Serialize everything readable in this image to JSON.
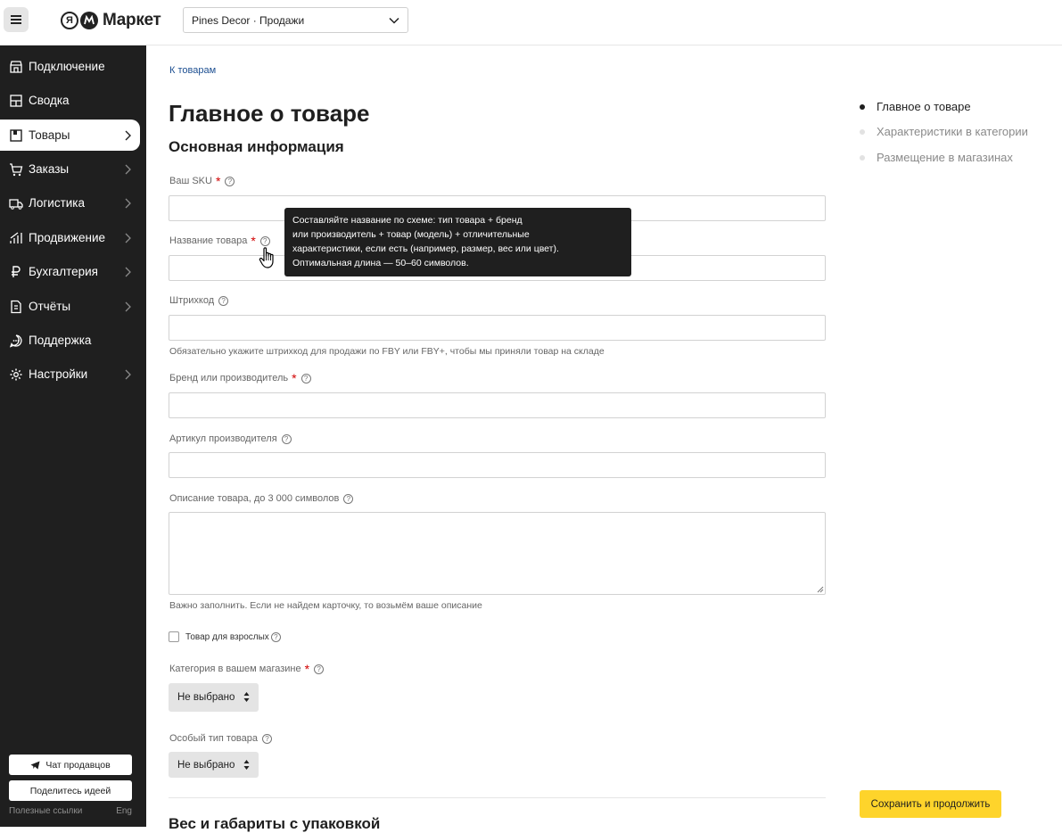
{
  "header": {
    "logo_text": "Маркет",
    "logo_ya": "Я",
    "shop_name": "Pines Decor · Продажи"
  },
  "sidebar": {
    "items": [
      {
        "label": "Подключение",
        "icon": "store-icon",
        "arrow": false
      },
      {
        "label": "Сводка",
        "icon": "dashboard-icon",
        "arrow": false
      },
      {
        "label": "Товары",
        "icon": "box-icon",
        "arrow": true,
        "active": true
      },
      {
        "label": "Заказы",
        "icon": "cart-icon",
        "arrow": true
      },
      {
        "label": "Логистика",
        "icon": "truck-icon",
        "arrow": true
      },
      {
        "label": "Продвижение",
        "icon": "chart-icon",
        "arrow": true
      },
      {
        "label": "Бухгалтерия",
        "icon": "ruble-icon",
        "arrow": true
      },
      {
        "label": "Отчёты",
        "icon": "report-icon",
        "arrow": true
      },
      {
        "label": "Поддержка",
        "icon": "chat-icon",
        "arrow": false
      },
      {
        "label": "Настройки",
        "icon": "gear-icon",
        "arrow": true
      }
    ],
    "chat_button": "Чат продавцов",
    "ideas_button": "Поделитесь идеей",
    "useful_links": "Полезные ссылки",
    "lang": "Eng"
  },
  "main": {
    "breadcrumb": "К товарам",
    "title": "Главное о товаре",
    "section_title": "Основная информация",
    "fields": {
      "sku_label": "Ваш SKU",
      "name_label": "Название товара",
      "barcode_label": "Штрихкод",
      "barcode_hint": "Обязательно укажите штрихкод для продажи по FBY или FBY+, чтобы мы приняли товар на складе",
      "brand_label": "Бренд или производитель",
      "vendor_code_label": "Артикул производителя",
      "description_label": "Описание товара, до 3 000 символов",
      "description_hint": "Важно заполнить. Если не найдем карточку, то возьмём ваше описание",
      "adult_label": "Товар для взрослых",
      "category_label": "Категория в вашем магазине",
      "category_value": "Не выбрано",
      "special_type_label": "Особый тип товара",
      "special_type_value": "Не выбрано"
    },
    "next_section_title": "Вес и габариты с упаковкой"
  },
  "tooltip": {
    "lines": [
      "Составляйте название по схеме: тип товара + бренд",
      "или производитель + товар (модель) + отличительные",
      "характеристики, если есть (например, размер, вес или цвет).",
      "Оптимальная длина — 50–60 символов."
    ]
  },
  "toc": {
    "items": [
      {
        "label": "Главное о товаре",
        "active": true
      },
      {
        "label": "Характеристики в категории",
        "active": false
      },
      {
        "label": "Размещение в магазинах",
        "active": false
      }
    ],
    "save_button": "Сохранить и продолжить"
  },
  "colors": {
    "sidebar_bg": "#1f1f1f",
    "accent_yellow": "#fed42b",
    "link_blue": "#1d4f91",
    "required_red": "#d10000"
  }
}
